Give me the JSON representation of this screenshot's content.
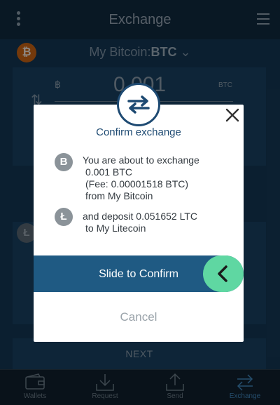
{
  "app": {
    "title": "Exchange",
    "wallet_from": {
      "prefix": "My Bitcoin:",
      "currency": "BTC"
    },
    "amount": {
      "symbol": "฿",
      "value": "0.001",
      "unit": "BTC"
    },
    "next_label": "NEXT"
  },
  "nav": [
    {
      "label": "Wallets",
      "icon": "wallet-icon",
      "active": false
    },
    {
      "label": "Request",
      "icon": "request-icon",
      "active": false
    },
    {
      "label": "Send",
      "icon": "send-icon",
      "active": false
    },
    {
      "label": "Exchange",
      "icon": "exchange-icon",
      "active": true
    }
  ],
  "dialog": {
    "title": "Confirm exchange",
    "btc_symbol": "B",
    "ltc_symbol": "Ł",
    "send_lines": [
      "You are about to exchange",
      "0.001 BTC",
      "(Fee:  0.00001518 BTC)",
      "from My Bitcoin"
    ],
    "deposit_lines": [
      "and deposit 0.051652 LTC",
      "to My Litecoin"
    ],
    "slide_label": "Slide to Confirm",
    "cancel_label": "Cancel"
  },
  "colors": {
    "accent": "#1e4a72",
    "slider": "#1f5a83",
    "knob": "#5fd7a2",
    "bitcoin": "#b35812"
  }
}
